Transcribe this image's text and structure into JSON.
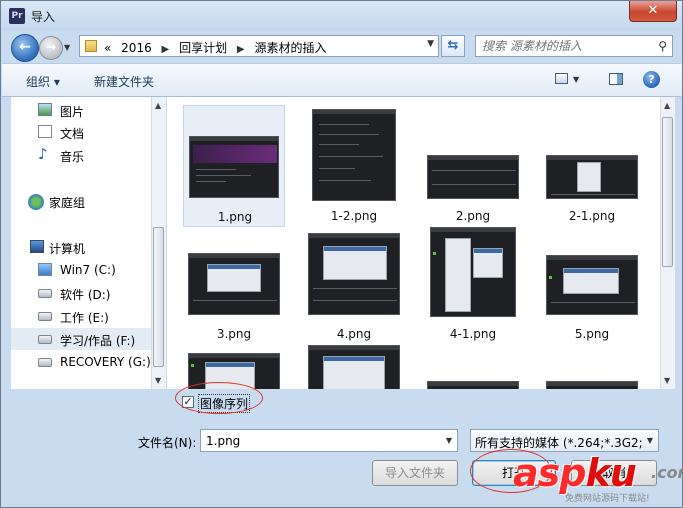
{
  "window": {
    "title": "导入",
    "app_icon_label": "Pr",
    "close_label": "✕"
  },
  "nav": {
    "breadcrumbs": [
      "«",
      "2016",
      "回享计划",
      "源素材的插入"
    ],
    "search_placeholder": "搜索 源素材的插入"
  },
  "toolbar": {
    "organize_label": "组织 ▾",
    "new_folder_label": "新建文件夹"
  },
  "sidebar": {
    "items": [
      {
        "label": "图片",
        "icon": "pictures-icon"
      },
      {
        "label": "文档",
        "icon": "documents-icon"
      },
      {
        "label": "音乐",
        "icon": "music-icon"
      },
      {
        "label": "家庭组",
        "icon": "homegroup-icon"
      },
      {
        "label": "计算机",
        "icon": "computer-icon"
      },
      {
        "label": "Win7 (C:)",
        "icon": "windows-drive-icon"
      },
      {
        "label": "软件 (D:)",
        "icon": "drive-icon"
      },
      {
        "label": "工作 (E:)",
        "icon": "drive-icon"
      },
      {
        "label": "学习/作品 (F:)",
        "icon": "drive-icon",
        "selected": true
      },
      {
        "label": "RECOVERY (G:)",
        "icon": "drive-icon"
      }
    ]
  },
  "files": [
    {
      "name": "1.png",
      "selected": true
    },
    {
      "name": "1-2.png"
    },
    {
      "name": "2.png"
    },
    {
      "name": "2-1.png"
    },
    {
      "name": "3.png"
    },
    {
      "name": "4.png"
    },
    {
      "name": "4-1.png"
    },
    {
      "name": "5.png"
    },
    {
      "name": ""
    },
    {
      "name": ""
    },
    {
      "name": ""
    },
    {
      "name": ""
    }
  ],
  "bottom": {
    "image_sequence_label": "图像序列",
    "image_sequence_checked": true,
    "filename_label": "文件名(N):",
    "filename_value": "1.png",
    "filetype_value": "所有支持的媒体 (*.264;*.3G2;*",
    "import_folder_label": "导入文件夹",
    "open_label": "打开",
    "cancel_label": "取消"
  },
  "watermark": {
    "main": "asp",
    "main2": "ku",
    "tld": ".com",
    "sub": "免费网站源码下载站!"
  }
}
